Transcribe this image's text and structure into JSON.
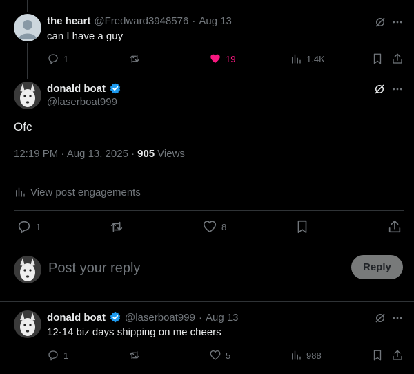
{
  "parent_post": {
    "name": "the heart",
    "handle": "@Fredward3948576",
    "sep": "·",
    "date": "Aug 13",
    "text": "can I have a guy",
    "replies": "1",
    "likes": "19",
    "views": "1.4K"
  },
  "main_post": {
    "name": "donald boat",
    "handle": "@laserboat999",
    "text": "Ofc",
    "timestamp": "12:19 PM · Aug 13, 2025 ·",
    "views_count": "905",
    "views_label": "Views",
    "engagements_label": "View post engagements",
    "replies": "1",
    "likes": "8"
  },
  "composer": {
    "placeholder": "Post your reply",
    "button_label": "Reply"
  },
  "reply_post": {
    "name": "donald boat",
    "handle": "@laserboat999",
    "sep": "·",
    "date": "Aug 13",
    "text": "12-14 biz days shipping on me cheers",
    "replies": "1",
    "likes": "5",
    "views": "988"
  },
  "icons": {
    "more": "more-icon",
    "grok": "grok-icon",
    "verified": "verified-badge-icon",
    "reply": "reply-icon",
    "retweet": "retweet-icon",
    "like": "heart-icon",
    "views": "views-icon",
    "bookmark": "bookmark-icon",
    "share": "share-icon"
  },
  "colors": {
    "background": "#000000",
    "text": "#e7e9ea",
    "muted": "#71767b",
    "like": "#f91880",
    "verified": "#1d9bf0",
    "divider": "#2f3336"
  }
}
